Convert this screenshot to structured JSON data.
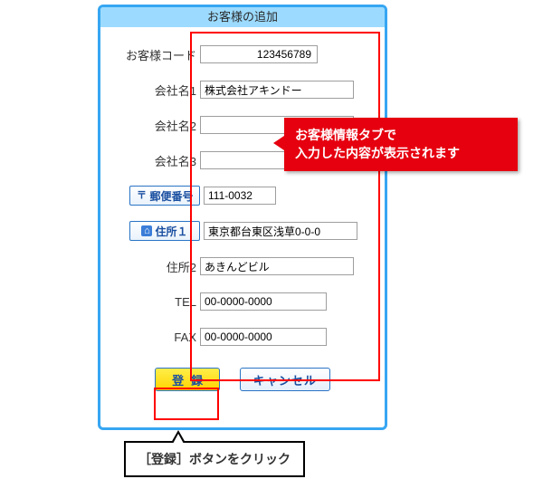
{
  "dialog": {
    "title": "お客様の追加",
    "fields": {
      "code_label": "お客様コード",
      "code_value": "123456789",
      "company1_label": "会社名1",
      "company1_value": "株式会社アキンドー",
      "company2_label": "会社名2",
      "company2_value": "",
      "company3_label": "会社名3",
      "company3_value": "",
      "postal_label": "郵便番号",
      "postal_value": "111-0032",
      "addr1_label": "住所１",
      "addr1_value": "東京都台東区浅草0-0-0",
      "addr2_label": "住所2",
      "addr2_value": "あきんどビル",
      "tel_label": "TEL",
      "tel_value": "00-0000-0000",
      "fax_label": "FAX",
      "fax_value": "00-0000-0000"
    },
    "buttons": {
      "register": "登録",
      "cancel": "キャンセル"
    }
  },
  "annotations": {
    "red_callout_line1": "お客様情報タブで",
    "red_callout_line2": "入力した内容が表示されます",
    "black_callout": "［登録］ボタンをクリック"
  },
  "icons": {
    "postal": "〒",
    "home": "⌂"
  }
}
